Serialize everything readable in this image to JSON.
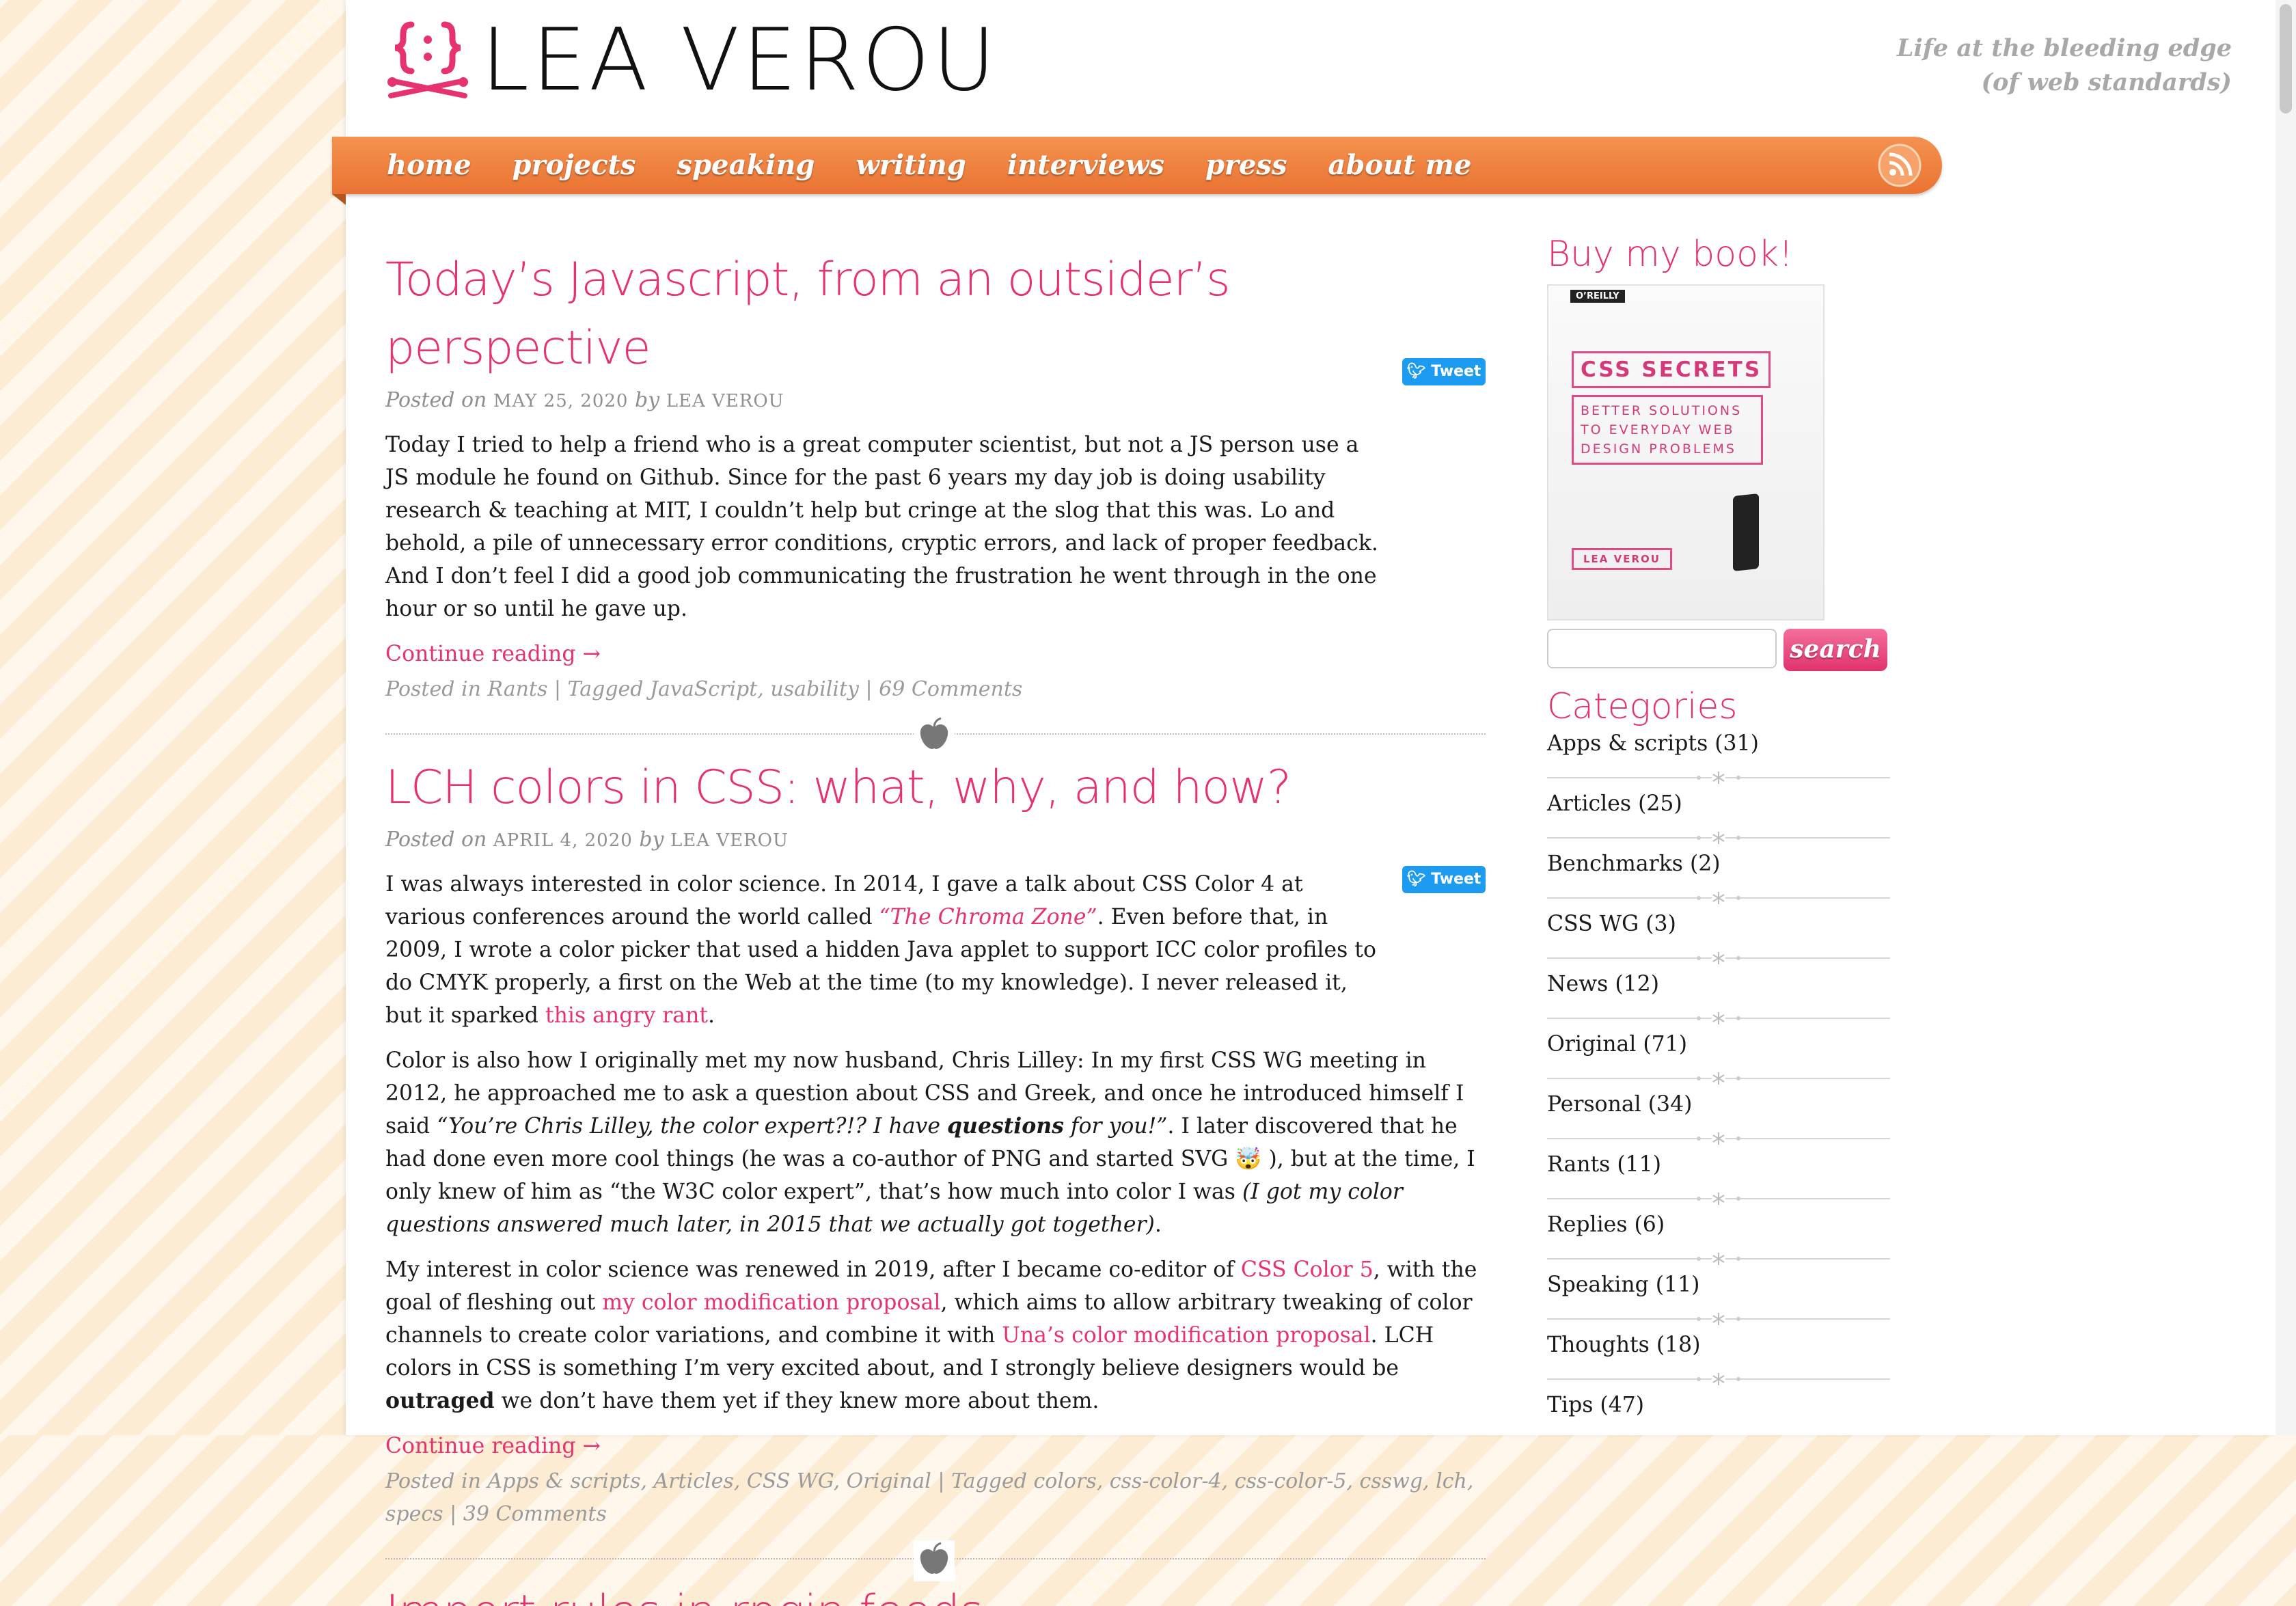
{
  "header": {
    "site_title": "LEA VEROU",
    "tagline_line1": "Life at the bleeding edge",
    "tagline_line2": "(of web standards)"
  },
  "nav": {
    "items": [
      "home",
      "projects",
      "speaking",
      "writing",
      "interviews",
      "press",
      "about me"
    ]
  },
  "posts": [
    {
      "title": "Today’s Javascript, from an outsider’s perspective",
      "posted_on": "Posted on",
      "date": "MAY 25, 2020",
      "by": "by",
      "author": "LEA VEROU",
      "tweet": "Tweet",
      "body": "Today I tried to help a friend who is a great computer scientist, but not a JS person use a JS module he found on Github. Since for the past 6 years my day job is doing usability research & teaching at MIT, I couldn’t help but cringe at the slog that this was. Lo and behold, a pile of unnecessary error conditions, cryptic errors, and lack of proper feedback. And I don’t feel I did a good job communicating the frustration he went through in the one hour or so until he gave up.",
      "continue": "Continue reading →",
      "footer": "Posted in Rants | Tagged JavaScript, usability | 69 Comments"
    },
    {
      "title": "LCH colors in CSS: what, why, and how?",
      "posted_on": "Posted on",
      "date": "APRIL 4, 2020",
      "by": "by",
      "author": "LEA VEROU",
      "tweet": "Tweet",
      "p1a": "I was always interested in color science. In 2014, I gave a talk about CSS Color 4 at various conferences around the world called ",
      "p1_link1": "“The Chroma Zone”",
      "p1b": ". Even before that, in 2009, I wrote a color picker that used a hidden Java applet to support ICC color profiles to do CMYK properly, a first on the Web at the time (to my knowledge). I never released it, but it sparked ",
      "p1_link2": "this angry rant",
      "p1c": ".",
      "p2a": "Color is also how I originally met my now husband, Chris Lilley: In my first CSS WG meeting in 2012, he approached me to ask a question about CSS and Greek, and once he introduced himself I said ",
      "p2_quote1": "“You’re Chris Lilley, the color expert?!? I have ",
      "p2_quote_bold": "questions",
      "p2_quote2": " for you!”",
      "p2b": ". I later discovered that he had done even more cool things (he was a co-author of PNG and started SVG 🤯 ), but at the time, I only knew of him as “the W3C color expert”, that’s how much into color I was ",
      "p2_italic": "(I got my color questions answered much later, in 2015 that we actually got together)",
      "p2c": ".",
      "p3a": "My interest in color science was renewed in 2019, after I became co-editor of ",
      "p3_link1": "CSS Color 5",
      "p3b": ", with the goal of fleshing out ",
      "p3_link2": "my color modification proposal",
      "p3c": ", which aims to allow arbitrary tweaking of color channels to create color variations, and combine it with ",
      "p3_link3": "Una’s color modification proposal",
      "p3d": ". LCH colors in CSS is something I’m very excited about, and I strongly believe designers would be ",
      "p3_bold": "outraged",
      "p3e": " we don’t have them yet if they knew more about them.",
      "continue": "Continue reading →",
      "footer": "Posted in Apps & scripts, Articles, CSS WG, Original | Tagged colors, css-color-4, css-color-5, csswg, lch, specs | 39 Comments"
    }
  ],
  "next_post_title_partial": "Import rules in rpgin feeds",
  "sidebar": {
    "book_heading": "Buy my book!",
    "book": {
      "publisher": "O’REILLY",
      "title": "CSS SECRETS",
      "subtitle_line1": "BETTER SOLUTIONS",
      "subtitle_line2": "TO EVERYDAY WEB",
      "subtitle_line3": "DESIGN PROBLEMS",
      "author": "LEA VEROU"
    },
    "search_button": "search",
    "search_placeholder": "",
    "categories_heading": "Categories",
    "categories": [
      "Apps & scripts (31)",
      "Articles (25)",
      "Benchmarks (2)",
      "CSS WG (3)",
      "News (12)",
      "Original (71)",
      "Personal (34)",
      "Rants (11)",
      "Replies (6)",
      "Speaking (11)",
      "Thoughts (18)",
      "Tips (47)"
    ]
  },
  "colors": {
    "accent_pink": "#e6336d",
    "nav_orange": "#ef8240",
    "tweet_blue": "#1d9bf0"
  }
}
